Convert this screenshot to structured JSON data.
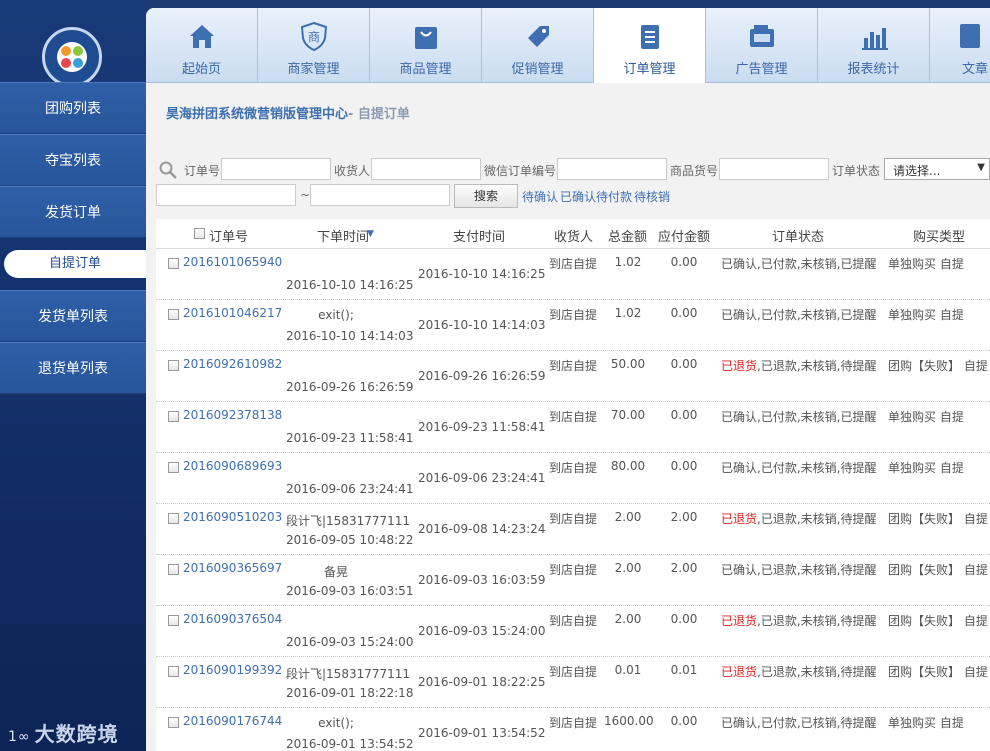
{
  "sidebar": {
    "items": [
      {
        "label": "团购列表"
      },
      {
        "label": "夺宝列表"
      },
      {
        "label": "发货订单"
      },
      {
        "label": "自提订单"
      },
      {
        "label": "发货单列表"
      },
      {
        "label": "退货单列表"
      }
    ],
    "brand_text": "大数跨境",
    "brand_mark": "1∞"
  },
  "topnav": {
    "tabs": [
      {
        "label": "起始页"
      },
      {
        "label": "商家管理"
      },
      {
        "label": "商品管理"
      },
      {
        "label": "促销管理"
      },
      {
        "label": "订单管理"
      },
      {
        "label": "广告管理"
      },
      {
        "label": "报表统计"
      },
      {
        "label": "文章"
      }
    ]
  },
  "breadcrumb": {
    "title": "昊海拼团系统微营销版管理中心",
    "sub": "- 自提订单"
  },
  "filter": {
    "order_no_label": "订单号",
    "receiver_label": "收货人",
    "wechat_label": "微信订单编号",
    "goods_label": "商品货号",
    "status_label": "订单状态",
    "status_selected": "请选择...",
    "date_sep": "~",
    "search_label": "搜索",
    "quick_links": [
      "待确认",
      "已确认待付款",
      "待核销"
    ]
  },
  "table": {
    "headers": {
      "order_no": "订单号",
      "order_time": "下单时间",
      "pay_time": "支付时间",
      "receiver": "收货人",
      "total": "总金额",
      "payable": "应付金额",
      "status": "订单状态",
      "buy_type": "购买类型"
    },
    "rows": [
      {
        "id": "2016101065940",
        "buyer": "",
        "order_time": "2016-10-10 14:16:25",
        "pay_time": "2016-10-10 14:16:25",
        "receiver": "到店自提",
        "total": "1.02",
        "payable": "0.00",
        "status_first": "已确认",
        "status_rest": ",已付款,未核销,已提醒",
        "buy_type": "单独购买 自提"
      },
      {
        "id": "2016101046217",
        "buyer": "exit();",
        "order_time": "2016-10-10 14:14:03",
        "pay_time": "2016-10-10 14:14:03",
        "receiver": "到店自提",
        "total": "1.02",
        "payable": "0.00",
        "status_first": "已确认",
        "status_rest": ",已付款,未核销,已提醒",
        "buy_type": "单独购买 自提"
      },
      {
        "id": "2016092610982",
        "buyer": "",
        "order_time": "2016-09-26 16:26:59",
        "pay_time": "2016-09-26 16:26:59",
        "receiver": "到店自提",
        "total": "50.00",
        "payable": "0.00",
        "status_first": "已退货",
        "status_rest": ",已退款,未核销,待提醒",
        "buy_type": "团购【失败】 自提"
      },
      {
        "id": "2016092378138",
        "buyer": "",
        "order_time": "2016-09-23 11:58:41",
        "pay_time": "2016-09-23 11:58:41",
        "receiver": "到店自提",
        "total": "70.00",
        "payable": "0.00",
        "status_first": "已确认",
        "status_rest": ",已付款,未核销,已提醒",
        "buy_type": "单独购买 自提"
      },
      {
        "id": "2016090689693",
        "buyer": "",
        "order_time": "2016-09-06 23:24:41",
        "pay_time": "2016-09-06 23:24:41",
        "receiver": "到店自提",
        "total": "80.00",
        "payable": "0.00",
        "status_first": "已确认",
        "status_rest": ",已付款,未核销,待提醒",
        "buy_type": "单独购买 自提"
      },
      {
        "id": "2016090510203",
        "buyer": "段计飞|15831777111",
        "order_time": "2016-09-05 10:48:22",
        "pay_time": "2016-09-08 14:23:24",
        "receiver": "到店自提",
        "total": "2.00",
        "payable": "2.00",
        "status_first": "已退货",
        "status_rest": ",已退款,未核销,待提醒",
        "buy_type": "团购【失败】 自提"
      },
      {
        "id": "2016090365697",
        "buyer": "备晃",
        "order_time": "2016-09-03 16:03:51",
        "pay_time": "2016-09-03 16:03:59",
        "receiver": "到店自提",
        "total": "2.00",
        "payable": "2.00",
        "status_first": "已确认",
        "status_rest": ",已退款,未核销,待提醒",
        "buy_type": "团购【失败】 自提"
      },
      {
        "id": "2016090376504",
        "buyer": "",
        "order_time": "2016-09-03 15:24:00",
        "pay_time": "2016-09-03 15:24:00",
        "receiver": "到店自提",
        "total": "2.00",
        "payable": "0.00",
        "status_first": "已退货",
        "status_rest": ",已退款,未核销,待提醒",
        "buy_type": "团购【失败】 自提"
      },
      {
        "id": "2016090199392",
        "buyer": "段计飞|15831777111",
        "order_time": "2016-09-01 18:22:18",
        "pay_time": "2016-09-01 18:22:25",
        "receiver": "到店自提",
        "total": "0.01",
        "payable": "0.01",
        "status_first": "已退货",
        "status_rest": ",已退款,未核销,待提醒",
        "buy_type": "团购【失败】 自提"
      },
      {
        "id": "2016090176744",
        "buyer": "exit();",
        "order_time": "2016-09-01 13:54:52",
        "pay_time": "2016-09-01 13:54:52",
        "receiver": "到店自提",
        "total": "1600.00",
        "payable": "0.00",
        "status_first": "已确认",
        "status_rest": ",已付款,已核销,待提醒",
        "buy_type": "单独购买 自提"
      }
    ]
  },
  "colors": {
    "accent": "#3e6fb0",
    "sidebar": "#183a78",
    "warn": "#dd2222"
  }
}
